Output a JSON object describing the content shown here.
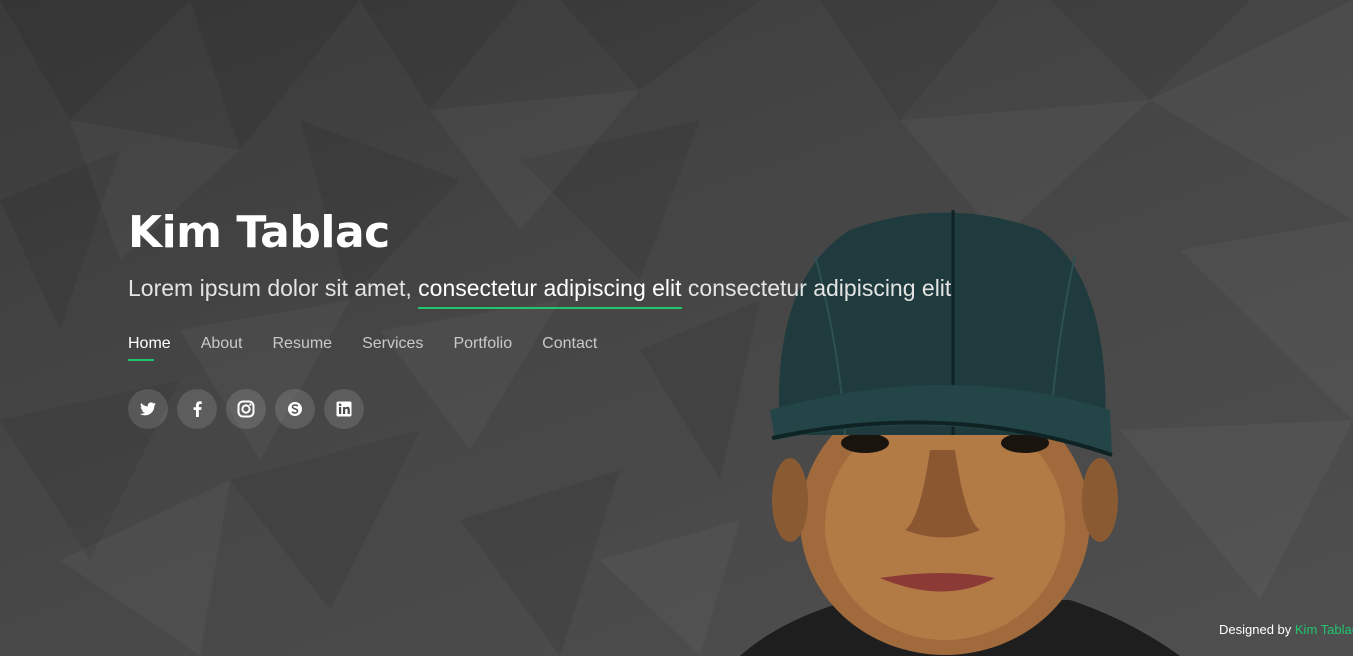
{
  "hero": {
    "name": "Kim Tablac",
    "tagline_prefix": "Lorem ipsum dolor sit amet, ",
    "tagline_highlight": "consectetur adipiscing elit",
    "tagline_suffix": " consectetur adipiscing elit"
  },
  "nav": {
    "items": [
      {
        "label": "Home",
        "active": true
      },
      {
        "label": "About"
      },
      {
        "label": "Resume"
      },
      {
        "label": "Services"
      },
      {
        "label": "Portfolio"
      },
      {
        "label": "Contact"
      }
    ]
  },
  "social": {
    "icons": [
      "twitter-icon",
      "facebook-icon",
      "instagram-icon",
      "skype-icon",
      "linkedin-icon"
    ]
  },
  "footer": {
    "credits_prefix": "Designed by ",
    "credits_link": "Kim Tablac"
  },
  "colors": {
    "accent": "#20c56e",
    "background": "#444444",
    "text": "#ffffff"
  }
}
